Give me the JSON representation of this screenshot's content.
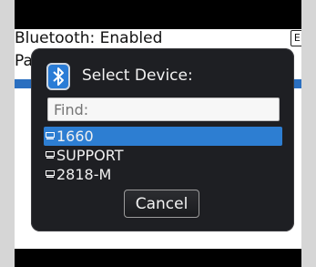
{
  "screen": {
    "title": "Bluetooth: Enabled",
    "lang_badge": "EN",
    "partial_row": "Pa"
  },
  "dialog": {
    "title": "Select Device:",
    "icon": "bluetooth-icon",
    "find_placeholder": "Find:",
    "devices": [
      {
        "label": "1660",
        "icon": "computer-icon",
        "selected": true
      },
      {
        "label": "SUPPORT",
        "icon": "computer-icon",
        "selected": false
      },
      {
        "label": "2818-M",
        "icon": "computer-icon",
        "selected": false
      }
    ],
    "cancel_label": "Cancel"
  },
  "colors": {
    "selection": "#2d7ed2",
    "dialog_bg": "#1e1f23",
    "bluetooth_icon": "#2a7cd6"
  }
}
